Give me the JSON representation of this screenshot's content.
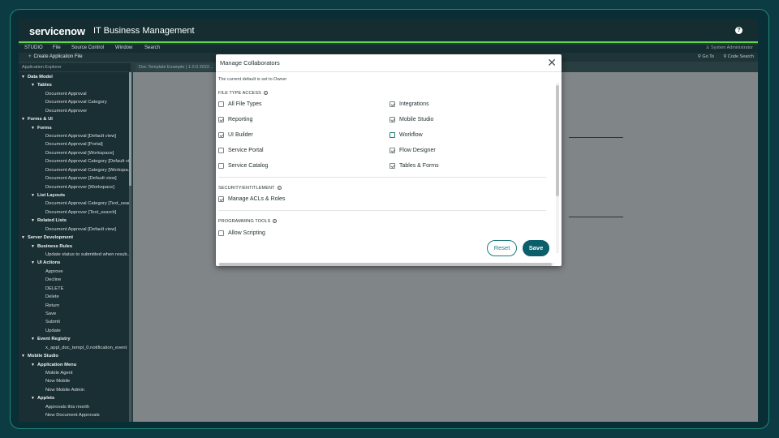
{
  "header": {
    "logo": "servicenow",
    "title": "IT Business Management",
    "help_icon": "?"
  },
  "menubar": {
    "items": [
      "STUDIO",
      "File",
      "Source Control",
      "Window",
      "Search"
    ],
    "user": "System Administrator",
    "user_icon": "person-icon"
  },
  "toolbar": {
    "create_label": "Create Application File",
    "goto_label": "Go To",
    "code_search_label": "Code Search"
  },
  "explorer": {
    "title": "Application Explorer"
  },
  "editor_tab": {
    "label": "Doc Template Example | 1.0.0.2022..."
  },
  "tree": [
    {
      "label": "Data Model",
      "level": 0,
      "bold": true,
      "expanded": true
    },
    {
      "label": "Tables",
      "level": 1,
      "bold": true,
      "expanded": true
    },
    {
      "label": "Document Approval",
      "level": 3
    },
    {
      "label": "Document Approval Category",
      "level": 3
    },
    {
      "label": "Document Approver",
      "level": 3
    },
    {
      "label": "Forms & UI",
      "level": 0,
      "bold": true,
      "expanded": true
    },
    {
      "label": "Forms",
      "level": 1,
      "bold": true,
      "expanded": true
    },
    {
      "label": "Document Approval [Default view]",
      "level": 3
    },
    {
      "label": "Document Approval [Portal]",
      "level": 3
    },
    {
      "label": "Document Approval [Workspace]",
      "level": 3
    },
    {
      "label": "Document Approval Category [Default vi...",
      "level": 3
    },
    {
      "label": "Document Approval Category [Workspa...",
      "level": 3
    },
    {
      "label": "Document Approver [Default view]",
      "level": 3
    },
    {
      "label": "Document Approver [Workspace]",
      "level": 3
    },
    {
      "label": "List Layouts",
      "level": 1,
      "bold": true,
      "expanded": true
    },
    {
      "label": "Document Approval Category [Text_sear...",
      "level": 3
    },
    {
      "label": "Document Approver [Text_search]",
      "level": 3
    },
    {
      "label": "Related Lists",
      "level": 1,
      "bold": true,
      "expanded": true
    },
    {
      "label": "Document Approval [Default view]",
      "level": 3
    },
    {
      "label": "Server Development",
      "level": 0,
      "bold": true,
      "expanded": true
    },
    {
      "label": "Business Rules",
      "level": 1,
      "bold": true,
      "expanded": true
    },
    {
      "label": "Update status to submitted when resub...",
      "level": 3
    },
    {
      "label": "UI Actions",
      "level": 1,
      "bold": true,
      "expanded": true
    },
    {
      "label": "Approve",
      "level": 3
    },
    {
      "label": "Decline",
      "level": 3
    },
    {
      "label": "DELETE",
      "level": 3
    },
    {
      "label": "Delete",
      "level": 3
    },
    {
      "label": "Return",
      "level": 3
    },
    {
      "label": "Save",
      "level": 3
    },
    {
      "label": "Submit",
      "level": 3
    },
    {
      "label": "Update",
      "level": 3
    },
    {
      "label": "Event Registry",
      "level": 1,
      "bold": true,
      "expanded": true
    },
    {
      "label": "x_appl_doc_templ_0.notification_event",
      "level": 3
    },
    {
      "label": "Mobile Studio",
      "level": 0,
      "bold": true,
      "expanded": true
    },
    {
      "label": "Application Menu",
      "level": 1,
      "bold": true,
      "expanded": true
    },
    {
      "label": "Mobile Agent",
      "level": 3
    },
    {
      "label": "Now Mobile",
      "level": 3
    },
    {
      "label": "Now Mobile Admin",
      "level": 3
    },
    {
      "label": "Applets",
      "level": 1,
      "bold": true,
      "expanded": true
    },
    {
      "label": "Approvals this month",
      "level": 3
    },
    {
      "label": "New Document Approvals",
      "level": 3
    }
  ],
  "modal": {
    "title": "Manage Collaborators",
    "subtitle": "The current default is set to Owner",
    "sections": [
      {
        "title": "FILE TYPE ACCESS",
        "options": [
          {
            "label": "All File Types",
            "checked": false
          },
          {
            "label": "Integrations",
            "checked": true
          },
          {
            "label": "Reporting",
            "checked": true
          },
          {
            "label": "Mobile Studio",
            "checked": true
          },
          {
            "label": "UI Builder",
            "checked": true
          },
          {
            "label": "Workflow",
            "checked": false
          },
          {
            "label": "Service Portal",
            "checked": false
          },
          {
            "label": "Flow Designer",
            "checked": true
          },
          {
            "label": "Service Catalog",
            "checked": false
          },
          {
            "label": "Tables & Forms",
            "checked": true
          }
        ]
      },
      {
        "title": "SECURITY/ENTITLEMENT",
        "options": [
          {
            "label": "Manage ACLs & Roles",
            "checked": true
          }
        ]
      },
      {
        "title": "PROGRAMMING TOOLS",
        "options": [
          {
            "label": "Allow Scripting",
            "checked": false
          }
        ]
      }
    ],
    "reset_label": "Reset",
    "save_label": "Save"
  }
}
